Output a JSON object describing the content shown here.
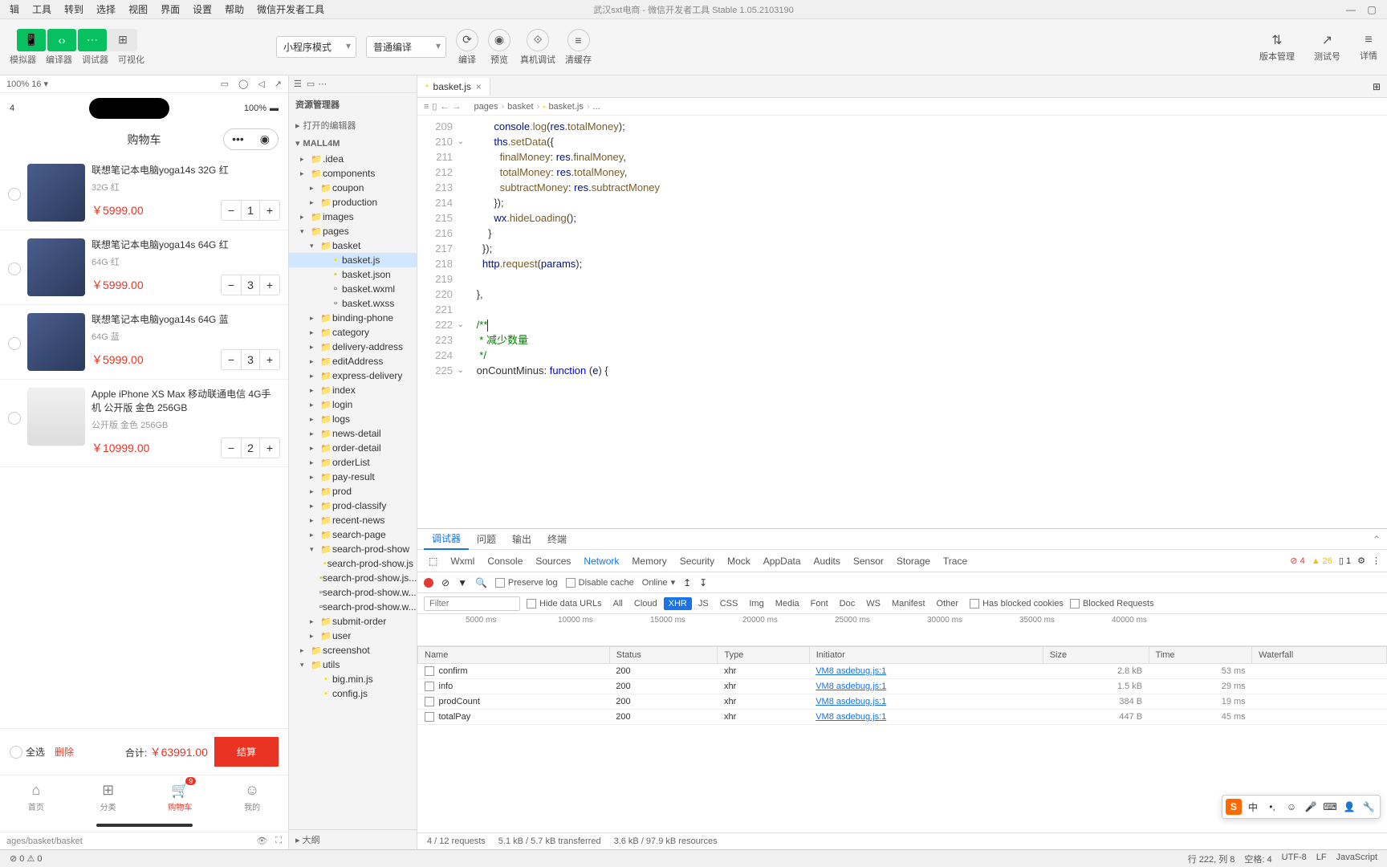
{
  "appTitle": "武汉sxt电商 - 微信开发者工具 Stable 1.05.2103190",
  "menu": [
    "辑",
    "工具",
    "转到",
    "选择",
    "视图",
    "界面",
    "设置",
    "帮助",
    "微信开发者工具"
  ],
  "toolbar": {
    "modeLabels": [
      "模拟器",
      "编译器",
      "调试器",
      "可视化"
    ],
    "leftDropdown": "小程序模式",
    "compileDropdown": "普通编译",
    "actions": [
      "编译",
      "预览",
      "真机调试",
      "清缓存"
    ],
    "right": [
      "版本管理",
      "测试号",
      "详情"
    ]
  },
  "simulator": {
    "zoom": "100% 16 ▾",
    "cartTitle": "购物车",
    "items": [
      {
        "name": "联想笔记本电脑yoga14s 32G 红",
        "spec": "32G 红",
        "price": "￥5999.00",
        "qty": "1"
      },
      {
        "name": "联想笔记本电脑yoga14s 64G 红",
        "spec": "64G 红",
        "price": "￥5999.00",
        "qty": "3"
      },
      {
        "name": "联想笔记本电脑yoga14s 64G 蓝",
        "spec": "64G 蓝",
        "price": "￥5999.00",
        "qty": "3"
      },
      {
        "name": "Apple iPhone XS Max 移动联通电信 4G手机 公开版 金色 256GB",
        "spec": "公开版 金色 256GB",
        "price": "￥10999.00",
        "qty": "2"
      }
    ],
    "footer": {
      "selectAll": "全选",
      "delete": "删除",
      "totalLabel": "合计:",
      "totalPrice": "￥63991.00",
      "checkout": "结算"
    },
    "tabs": [
      {
        "label": "首页",
        "icon": "⌂"
      },
      {
        "label": "分类",
        "icon": "⊞"
      },
      {
        "label": "购物车",
        "icon": "🛒",
        "badge": "9",
        "active": true
      },
      {
        "label": "我的",
        "icon": "☺"
      }
    ],
    "statusTime": "4",
    "batt": "100%",
    "path": "ages/basket/basket"
  },
  "explorer": {
    "title": "资源管理器",
    "openEditors": "打开的编辑器",
    "project": "MALL4M",
    "tree": [
      {
        "d": 1,
        "t": "folder",
        "l": ".idea"
      },
      {
        "d": 1,
        "t": "folder",
        "l": "components"
      },
      {
        "d": 2,
        "t": "folder",
        "l": "coupon"
      },
      {
        "d": 2,
        "t": "folder",
        "l": "production"
      },
      {
        "d": 1,
        "t": "folder",
        "l": "images"
      },
      {
        "d": 1,
        "t": "folder-open",
        "l": "pages"
      },
      {
        "d": 2,
        "t": "folder-open",
        "l": "basket"
      },
      {
        "d": 3,
        "t": "js",
        "l": "basket.js",
        "sel": true
      },
      {
        "d": 3,
        "t": "json",
        "l": "basket.json"
      },
      {
        "d": 3,
        "t": "file",
        "l": "basket.wxml"
      },
      {
        "d": 3,
        "t": "file",
        "l": "basket.wxss"
      },
      {
        "d": 2,
        "t": "folder",
        "l": "binding-phone"
      },
      {
        "d": 2,
        "t": "folder",
        "l": "category"
      },
      {
        "d": 2,
        "t": "folder",
        "l": "delivery-address"
      },
      {
        "d": 2,
        "t": "folder",
        "l": "editAddress"
      },
      {
        "d": 2,
        "t": "folder",
        "l": "express-delivery"
      },
      {
        "d": 2,
        "t": "folder",
        "l": "index"
      },
      {
        "d": 2,
        "t": "folder",
        "l": "login"
      },
      {
        "d": 2,
        "t": "folder",
        "l": "logs"
      },
      {
        "d": 2,
        "t": "folder",
        "l": "news-detail"
      },
      {
        "d": 2,
        "t": "folder",
        "l": "order-detail"
      },
      {
        "d": 2,
        "t": "folder",
        "l": "orderList"
      },
      {
        "d": 2,
        "t": "folder",
        "l": "pay-result"
      },
      {
        "d": 2,
        "t": "folder",
        "l": "prod"
      },
      {
        "d": 2,
        "t": "folder",
        "l": "prod-classify"
      },
      {
        "d": 2,
        "t": "folder",
        "l": "recent-news"
      },
      {
        "d": 2,
        "t": "folder",
        "l": "search-page"
      },
      {
        "d": 2,
        "t": "folder-open",
        "l": "search-prod-show"
      },
      {
        "d": 3,
        "t": "js",
        "l": "search-prod-show.js"
      },
      {
        "d": 3,
        "t": "json",
        "l": "search-prod-show.js..."
      },
      {
        "d": 3,
        "t": "file",
        "l": "search-prod-show.w..."
      },
      {
        "d": 3,
        "t": "file",
        "l": "search-prod-show.w..."
      },
      {
        "d": 2,
        "t": "folder",
        "l": "submit-order"
      },
      {
        "d": 2,
        "t": "folder",
        "l": "user"
      },
      {
        "d": 1,
        "t": "folder",
        "l": "screenshot"
      },
      {
        "d": 1,
        "t": "folder-open",
        "l": "utils"
      },
      {
        "d": 2,
        "t": "js",
        "l": "big.min.js"
      },
      {
        "d": 2,
        "t": "js",
        "l": "config.js"
      }
    ],
    "outline": "大纲"
  },
  "editor": {
    "tab": "basket.js",
    "breadcrumb": [
      "pages",
      "basket",
      "basket.js",
      "..."
    ],
    "startLine": 209,
    "lines": [
      "            console.log(res.totalMoney);",
      "            ths.setData({",
      "              finalMoney: res.finalMoney,",
      "              totalMoney: res.totalMoney,",
      "              subtractMoney: res.subtractMoney",
      "            });",
      "            wx.hideLoading();",
      "          }",
      "        });",
      "        http.request(params);",
      "",
      "      },",
      "",
      "      /**",
      "       * 减少数量",
      "       */",
      "      onCountMinus: function (e) {"
    ]
  },
  "devtools": {
    "subtabs": [
      "调试器",
      "问题",
      "输出",
      "终端"
    ],
    "maintabs": [
      "Wxml",
      "Console",
      "Sources",
      "Network",
      "Memory",
      "Security",
      "Mock",
      "AppData",
      "Audits",
      "Sensor",
      "Storage",
      "Trace"
    ],
    "activeMain": "Network",
    "status": {
      "err": "4",
      "warn": "26",
      "info": "1"
    },
    "ctrlLabels": {
      "preserve": "Preserve log",
      "disable": "Disable cache",
      "online": "Online"
    },
    "filterPlaceholder": "Filter",
    "filterLabels": {
      "hideUrls": "Hide data URLs",
      "blocked": "Has blocked cookies",
      "blockedReq": "Blocked Requests"
    },
    "chips": [
      "All",
      "Cloud",
      "XHR",
      "JS",
      "CSS",
      "Img",
      "Media",
      "Font",
      "Doc",
      "WS",
      "Manifest",
      "Other"
    ],
    "ticks": [
      "5000 ms",
      "10000 ms",
      "15000 ms",
      "20000 ms",
      "25000 ms",
      "30000 ms",
      "35000 ms",
      "40000 ms"
    ],
    "cols": [
      "Name",
      "Status",
      "Type",
      "Initiator",
      "Size",
      "Time",
      "Waterfall"
    ],
    "rows": [
      {
        "name": "confirm",
        "status": "200",
        "type": "xhr",
        "init": "VM8 asdebug.js:1",
        "size": "2.8 kB",
        "time": "53 ms"
      },
      {
        "name": "info",
        "status": "200",
        "type": "xhr",
        "init": "VM8 asdebug.js:1",
        "size": "1.5 kB",
        "time": "29 ms"
      },
      {
        "name": "prodCount",
        "status": "200",
        "type": "xhr",
        "init": "VM8 asdebug.js:1",
        "size": "384 B",
        "time": "19 ms"
      },
      {
        "name": "totalPay",
        "status": "200",
        "type": "xhr",
        "init": "VM8 asdebug.js:1",
        "size": "447 B",
        "time": "45 ms"
      }
    ],
    "summary": [
      "4 / 12 requests",
      "5.1 kB / 5.7 kB transferred",
      "3.6 kB / 97.9 kB resources"
    ]
  },
  "statusbar": {
    "left": [
      "⊘ 0  ⚠ 0"
    ],
    "right": [
      "行 222, 列 8",
      "空格: 4",
      "UTF-8",
      "LF",
      "JavaScript"
    ]
  }
}
